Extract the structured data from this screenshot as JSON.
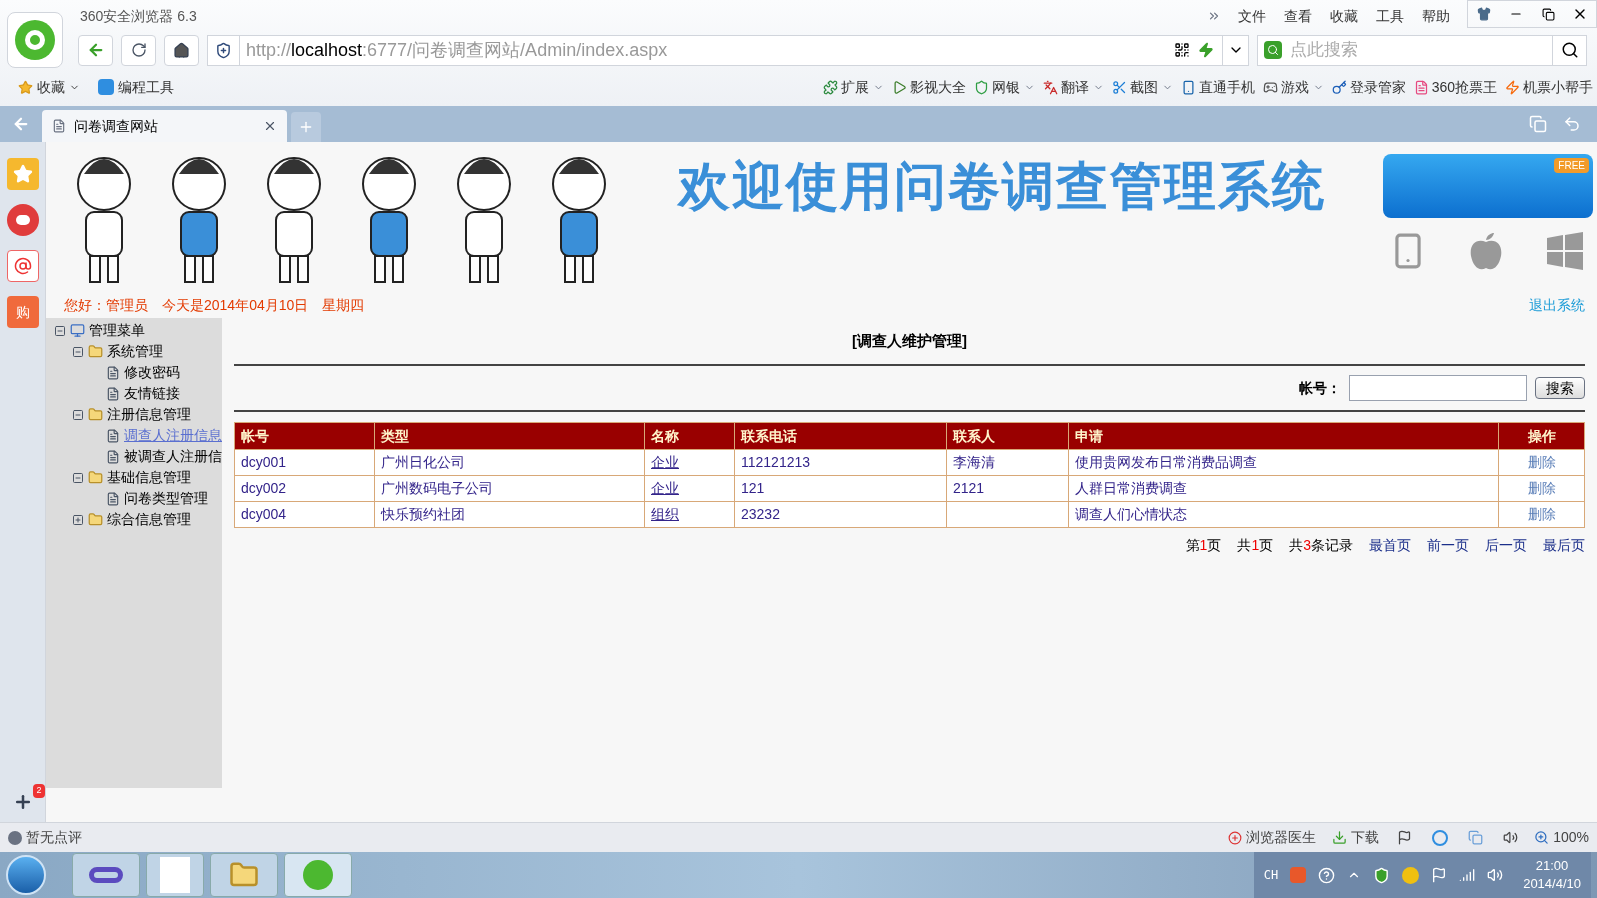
{
  "browser": {
    "title": "360安全浏览器 6.3",
    "menu": [
      "文件",
      "查看",
      "收藏",
      "工具",
      "帮助"
    ],
    "url": {
      "scheme": "http://",
      "host": "localhost",
      "path": ":6777/问卷调查网站/Admin/index.aspx"
    },
    "search_placeholder": "点此搜索",
    "bookmarks_left": [
      {
        "label": "收藏",
        "dropdown": true
      },
      {
        "label": "编程工具",
        "dropdown": false
      }
    ],
    "bookmarks_right": [
      {
        "label": "扩展",
        "dropdown": true
      },
      {
        "label": "影视大全",
        "dropdown": false
      },
      {
        "label": "网银",
        "dropdown": true
      },
      {
        "label": "翻译",
        "dropdown": true
      },
      {
        "label": "截图",
        "dropdown": true
      },
      {
        "label": "直通手机",
        "dropdown": false
      },
      {
        "label": "游戏",
        "dropdown": true
      },
      {
        "label": "登录管家",
        "dropdown": false
      },
      {
        "label": "360抢票王",
        "dropdown": false
      },
      {
        "label": "机票小帮手",
        "dropdown": false
      }
    ],
    "tabs": [
      {
        "label": "问卷调查网站",
        "selected": true
      }
    ],
    "side_strip": {
      "shop_label": "购",
      "badge": "2"
    }
  },
  "page": {
    "banner_title": "欢迎使用问卷调查管理系统",
    "banner_ribbon": "FREE",
    "greeting": [
      "您好：管理员",
      "今天是2014年04月10日",
      "星期四"
    ],
    "logout": "退出系统",
    "menu": [
      {
        "label": "管理菜单",
        "kind": "root",
        "expanded": true,
        "children": [
          {
            "label": "系统管理",
            "kind": "folder",
            "expanded": true,
            "children": [
              {
                "label": "修改密码",
                "kind": "page",
                "selected": false
              },
              {
                "label": "友情链接",
                "kind": "page",
                "selected": false
              }
            ]
          },
          {
            "label": "注册信息管理",
            "kind": "folder",
            "expanded": true,
            "children": [
              {
                "label": "调查人注册信息",
                "kind": "page",
                "selected": true
              },
              {
                "label": "被调查人注册信",
                "kind": "page",
                "selected": false
              }
            ]
          },
          {
            "label": "基础信息管理",
            "kind": "folder",
            "expanded": true,
            "children": [
              {
                "label": "问卷类型管理",
                "kind": "page",
                "selected": false
              }
            ]
          },
          {
            "label": "综合信息管理",
            "kind": "folder",
            "expanded": false
          }
        ]
      }
    ],
    "section_title": "[调查人维护管理]",
    "search": {
      "label": "帐号：",
      "button": "搜索"
    },
    "table": {
      "columns": [
        "帐号",
        "类型",
        "名称",
        "联系电话",
        "联系人",
        "申请",
        "操作"
      ],
      "rows": [
        [
          "dcy001",
          "广州日化公司",
          "企业",
          "112121213",
          "李海清",
          "使用贵网发布日常消费品调查",
          "删除"
        ],
        [
          "dcy002",
          "广州数码电子公司",
          "企业",
          "121",
          "2121",
          "人群日常消费调查",
          "删除"
        ],
        [
          "dcy004",
          "快乐预约社团",
          "组织",
          "23232",
          "",
          "调查人们心情状态",
          "删除"
        ]
      ]
    },
    "pager": {
      "page": [
        "第",
        "1",
        "页"
      ],
      "total_pages": [
        "共",
        "1",
        "页"
      ],
      "records": [
        "共",
        "3",
        "条记录"
      ],
      "links": [
        "最首页",
        "前一页",
        "后一页",
        "最后页"
      ]
    }
  },
  "status_bar": {
    "left": "暂无点评",
    "items": [
      "浏览器医生",
      "下载"
    ],
    "zoom": "100%"
  },
  "taskbar": {
    "lang": "CH",
    "time": "21:00",
    "date": "2014/4/10"
  }
}
